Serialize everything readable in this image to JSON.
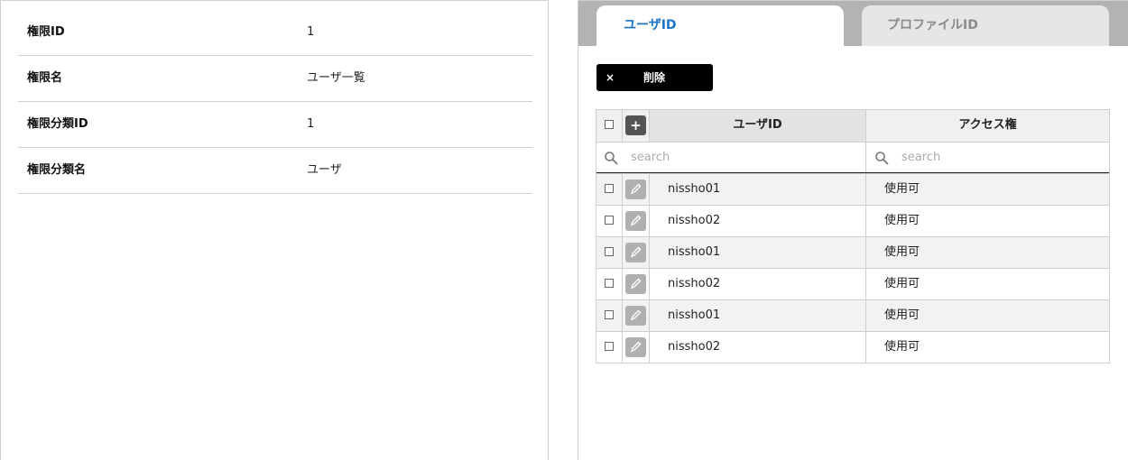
{
  "details": [
    {
      "label": "権限ID",
      "value": "1"
    },
    {
      "label": "権限名",
      "value": "ユーザ一覧"
    },
    {
      "label": "権限分類ID",
      "value": "1"
    },
    {
      "label": "権限分類名",
      "value": "ユーザ"
    }
  ],
  "tabs": {
    "active": "ユーザID",
    "inactive": "プロファイルID"
  },
  "toolbar": {
    "delete_icon": "×",
    "delete_label": "削除"
  },
  "table": {
    "add_icon": "+",
    "columns": [
      "ユーザID",
      "アクセス権"
    ],
    "search_placeholder": [
      "search",
      "search"
    ],
    "rows": [
      {
        "user": "nissho01",
        "access": "使用可"
      },
      {
        "user": "nissho02",
        "access": "使用可"
      },
      {
        "user": "nissho01",
        "access": "使用可"
      },
      {
        "user": "nissho02",
        "access": "使用可"
      },
      {
        "user": "nissho01",
        "access": "使用可"
      },
      {
        "user": "nissho02",
        "access": "使用可"
      }
    ]
  },
  "colors": {
    "active_tab_text": "#1a73c8",
    "tab_strip": "#b3b3b3",
    "delete_button": "#000000"
  }
}
